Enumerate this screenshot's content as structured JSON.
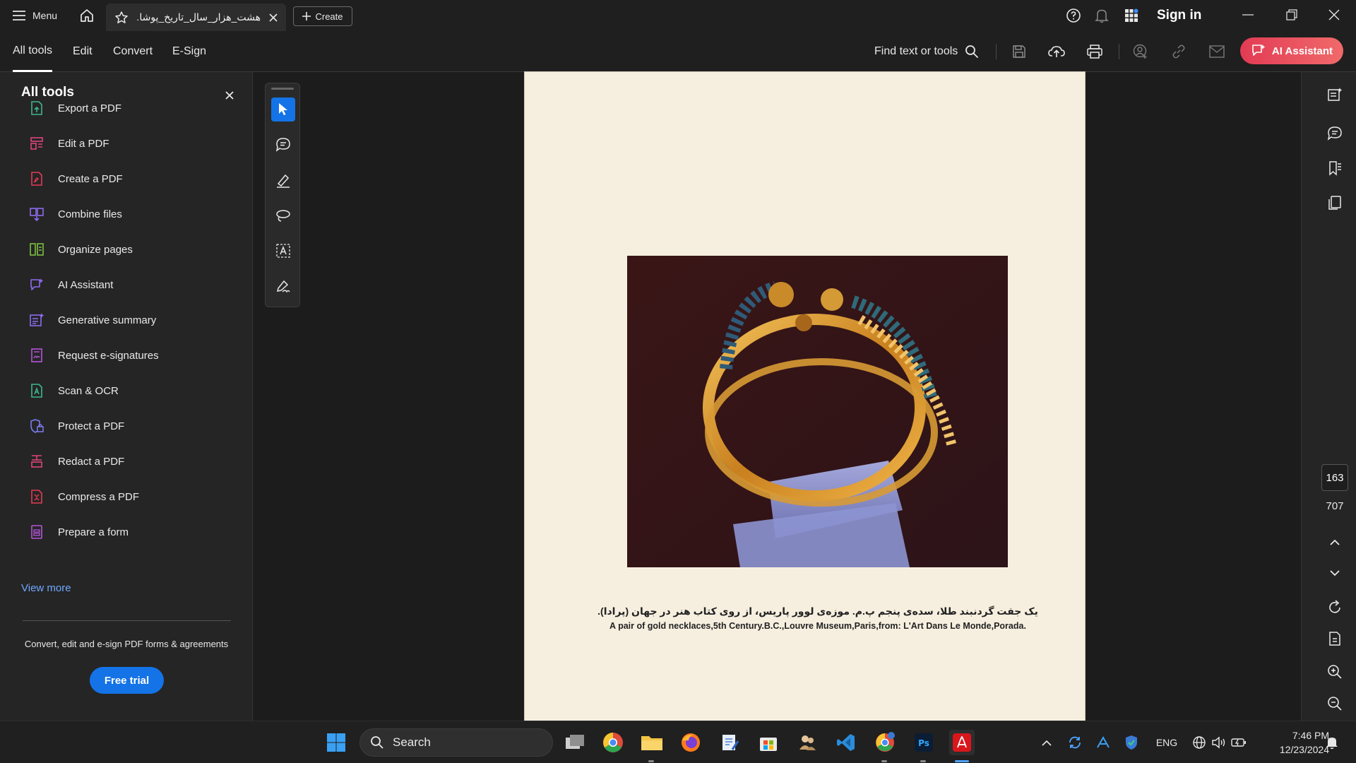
{
  "titlebar": {
    "menu_label": "Menu",
    "tab_title": "هشت_هزار_سال_تاریخ_پوشا..",
    "create_label": "Create",
    "sign_in_label": "Sign in"
  },
  "toolbar": {
    "tabs": [
      {
        "label": "All tools"
      },
      {
        "label": "Edit"
      },
      {
        "label": "Convert"
      },
      {
        "label": "E-Sign"
      }
    ],
    "find_label": "Find text or tools",
    "ai_assistant_label": "AI Assistant"
  },
  "left_panel": {
    "title": "All tools",
    "items": [
      {
        "label": "Export a PDF",
        "icon": "export-pdf-icon",
        "color": "#3fb68b"
      },
      {
        "label": "Edit a PDF",
        "icon": "edit-pdf-icon",
        "color": "#e0457b"
      },
      {
        "label": "Create a PDF",
        "icon": "create-pdf-icon",
        "color": "#e23b54"
      },
      {
        "label": "Combine files",
        "icon": "combine-files-icon",
        "color": "#8c6cf0"
      },
      {
        "label": "Organize pages",
        "icon": "organize-pages-icon",
        "color": "#7bc043"
      },
      {
        "label": "AI Assistant",
        "icon": "ai-assistant-icon",
        "color": "#8c6cf0"
      },
      {
        "label": "Generative summary",
        "icon": "generative-summary-icon",
        "color": "#8c6cf0"
      },
      {
        "label": "Request e-signatures",
        "icon": "request-esignatures-icon",
        "color": "#b455d8"
      },
      {
        "label": "Scan & OCR",
        "icon": "scan-ocr-icon",
        "color": "#3fb68b"
      },
      {
        "label": "Protect a PDF",
        "icon": "protect-pdf-icon",
        "color": "#7b7bf0"
      },
      {
        "label": "Redact a PDF",
        "icon": "redact-pdf-icon",
        "color": "#e0457b"
      },
      {
        "label": "Compress a PDF",
        "icon": "compress-pdf-icon",
        "color": "#e23b54"
      },
      {
        "label": "Prepare a form",
        "icon": "prepare-form-icon",
        "color": "#b455d8"
      }
    ],
    "view_more": "View more",
    "promo_text": "Convert, edit and e-sign PDF forms & agreements",
    "free_trial_label": "Free trial"
  },
  "document": {
    "caption_fa": "یک جفت گردنبند طلا، سده‌ی پنجم پ.م. موزه‌ی لوور پاریس، از روی کتاب هنر در جهان (پرادا).",
    "caption_en": "A pair of gold necklaces,5th Century.B.C.,Louvre Museum,Paris,from: L'Art Dans Le Monde,Porada."
  },
  "right_rail": {
    "current_page": "163",
    "total_pages": "707"
  },
  "taskbar": {
    "search_label": "Search",
    "language": "ENG",
    "time": "7:46 PM",
    "date": "12/23/2024"
  },
  "colors": {
    "accent_blue": "#1473e6",
    "ai_red": "#e23b54",
    "page_bg": "#f6efdf"
  }
}
